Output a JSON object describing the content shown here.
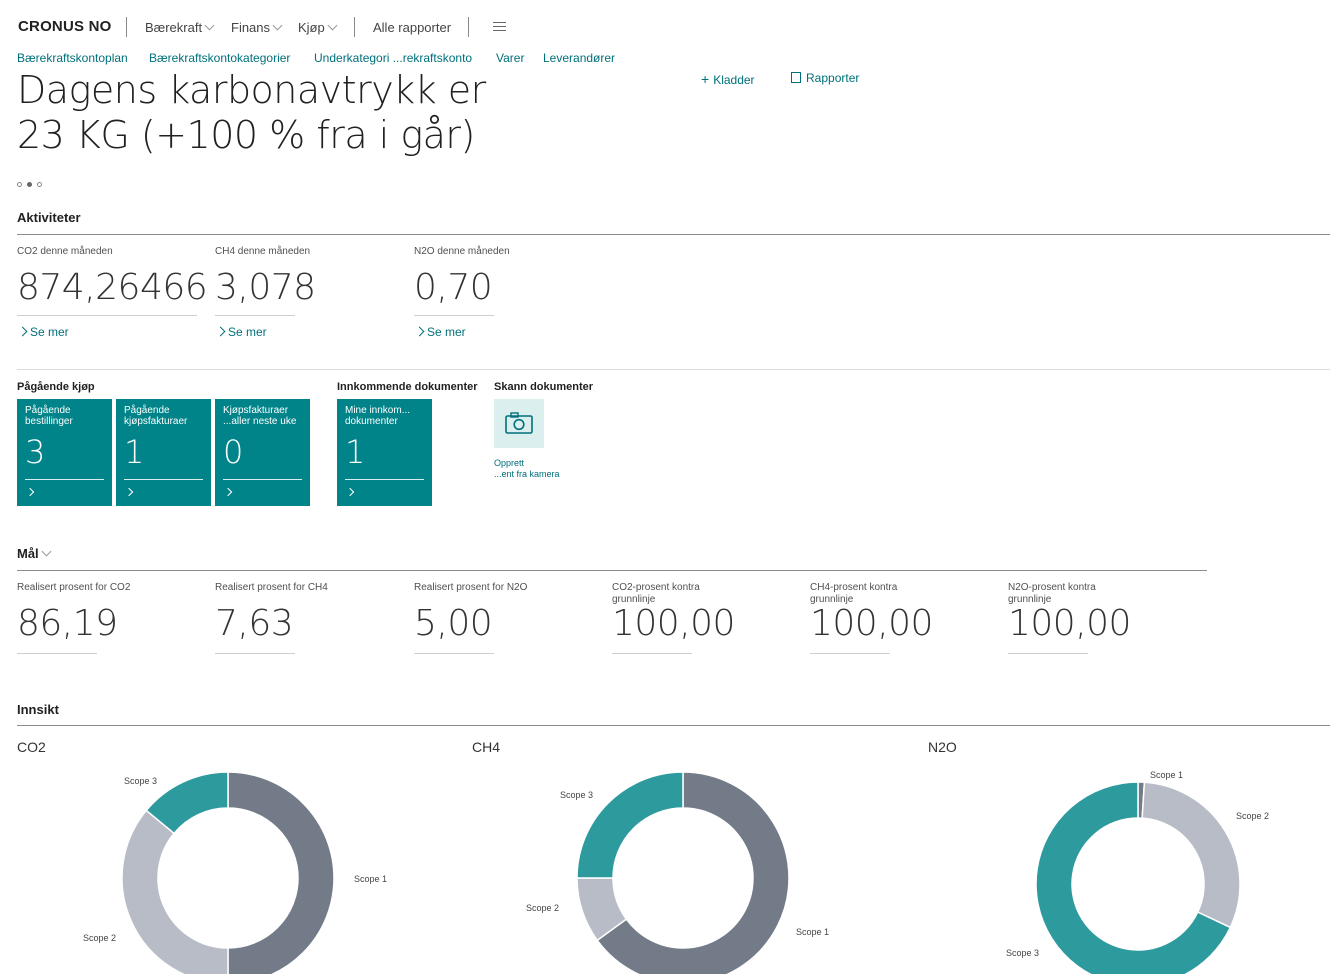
{
  "nav": {
    "company": "CRONUS NO",
    "menus": [
      {
        "label": "Bærekraft"
      },
      {
        "label": "Finans"
      },
      {
        "label": "Kjøp"
      }
    ],
    "all_reports": "Alle rapporter"
  },
  "links": [
    "Bærekraftskontoplan",
    "Bærekraftskontokategorier",
    "Underkategori ...rekraftskonto",
    "Varer",
    "Leverandører"
  ],
  "actions": {
    "journals": "Kladder",
    "reports": "Rapporter"
  },
  "headline": "Dagens karbonavtrykk er 23 KG (+100 % fra i går)",
  "carousel": {
    "count": 3,
    "active": 1
  },
  "activities": {
    "title": "Aktiviteter",
    "cues": [
      {
        "label": "CO2 denne måneden",
        "value": "874,26466",
        "link": "Se mer"
      },
      {
        "label": "CH4 denne måneden",
        "value": "3,078",
        "link": "Se mer"
      },
      {
        "label": "N2O denne måneden",
        "value": "0,70",
        "link": "Se mer"
      }
    ]
  },
  "ongoing": {
    "title": "Pågående kjøp",
    "tiles": [
      {
        "label": "Pågående bestillinger",
        "value": "3"
      },
      {
        "label": "Pågående kjøpsfakturaer",
        "value": "1"
      },
      {
        "label": "Kjøpsfakturaer ...aller neste uke",
        "value": "0"
      }
    ]
  },
  "incoming": {
    "title": "Innkommende dokumenter",
    "tiles": [
      {
        "label": "Mine innkom... dokumenter",
        "value": "1"
      }
    ]
  },
  "scan": {
    "title": "Skann dokumenter",
    "label_line1": "Opprett",
    "label_line2": "...ent fra kamera"
  },
  "goals": {
    "title": "Mål",
    "cues": [
      {
        "label": "Realisert prosent for CO2",
        "value": "86,19"
      },
      {
        "label": "Realisert prosent for CH4",
        "value": "7,63"
      },
      {
        "label": "Realisert prosent for N2O",
        "value": "5,00"
      },
      {
        "label": "CO2-prosent kontra grunnlinje",
        "value": "100,00"
      },
      {
        "label": "CH4-prosent kontra grunnlinje",
        "value": "100,00"
      },
      {
        "label": "N2O-prosent kontra grunnlinje",
        "value": "100,00"
      }
    ]
  },
  "insight": {
    "title": "Innsikt"
  },
  "colors": {
    "accent": "#008489",
    "link": "#00707a",
    "scope1_co2": "#737b88",
    "scope2_light": "#b8bcc6",
    "scope3_teal": "#2d9a9e"
  },
  "chart_data": [
    {
      "type": "pie",
      "title": "CO2",
      "categories": [
        "Scope 1",
        "Scope 2",
        "Scope 3"
      ],
      "values": [
        50,
        36,
        14
      ],
      "colors": [
        "#737b88",
        "#b8bcc6",
        "#2d9a9e"
      ]
    },
    {
      "type": "pie",
      "title": "CH4",
      "categories": [
        "Scope 1",
        "Scope 2",
        "Scope 3"
      ],
      "values": [
        65,
        10,
        25
      ],
      "colors": [
        "#737b88",
        "#b8bcc6",
        "#2d9a9e"
      ]
    },
    {
      "type": "pie",
      "title": "N2O",
      "categories": [
        "Scope 1",
        "Scope 2",
        "Scope 3"
      ],
      "values": [
        1,
        31,
        68
      ],
      "colors": [
        "#737b88",
        "#b8bcc6",
        "#2d9a9e"
      ]
    }
  ]
}
